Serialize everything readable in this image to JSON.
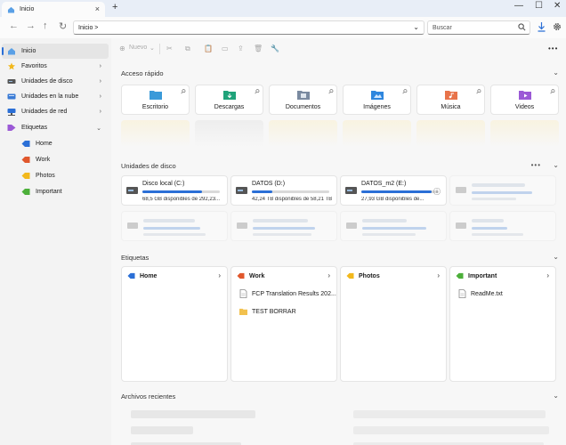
{
  "window": {
    "tab_label": "Inicio",
    "tab_close": "×",
    "new_tab": "+",
    "minimize": "—",
    "maximize": "☐",
    "close": "✕"
  },
  "nav": {
    "back": "←",
    "forward": "→",
    "up": "↑",
    "refresh": "↻",
    "address": "Inicio  >",
    "address_chevron": "⌄",
    "search_placeholder": "Buscar"
  },
  "sidebar": {
    "items": [
      {
        "label": "Inicio"
      },
      {
        "label": "Favoritos"
      },
      {
        "label": "Unidades de disco"
      },
      {
        "label": "Unidades en la nube"
      },
      {
        "label": "Unidades de red"
      },
      {
        "label": "Etiquetas"
      },
      {
        "label": "Home"
      },
      {
        "label": "Work"
      },
      {
        "label": "Photos"
      },
      {
        "label": "Important"
      }
    ],
    "chevron_right": "›",
    "chevron_down": "⌄"
  },
  "toolbar": {
    "new_label": "Nuevo",
    "new_chevron": "⌄",
    "more": "•••"
  },
  "quick_access": {
    "title": "Acceso rápido",
    "chevron": "⌄",
    "pin": "📌",
    "items": [
      {
        "label": "Escritorio",
        "color": "#3a9ad9"
      },
      {
        "label": "Descargas",
        "color": "#1fa37a"
      },
      {
        "label": "Documentos",
        "color": "#7a8aa0"
      },
      {
        "label": "Imágenes",
        "color": "#2e86de"
      },
      {
        "label": "Música",
        "color": "#e8734a"
      },
      {
        "label": "Videos",
        "color": "#9b59d6"
      }
    ]
  },
  "drives": {
    "title": "Unidades de disco",
    "dots": "•••",
    "chevron": "⌄",
    "items": [
      {
        "name": "Disco local (C:)",
        "free": "68,5 GB disponibles de 292,23...",
        "used_fraction": 0.77
      },
      {
        "name": "DATOS (D:)",
        "free": "42,24 TB disponibles de 58,21 TB",
        "used_fraction": 0.27
      },
      {
        "name": "DATOS_m2 (E:)",
        "free": "27,93 GB disponibles de...",
        "used_fraction": 0.91,
        "info": "ⓘ"
      }
    ]
  },
  "tags": {
    "title": "Etiquetas",
    "chevron": "⌄",
    "card_chevron": "›",
    "cards": [
      {
        "label": "Home",
        "color": "#2b6fd6",
        "files": []
      },
      {
        "label": "Work",
        "color": "#e0572c",
        "files": [
          {
            "name": "FCP Translation Results 202...",
            "kind": "document"
          },
          {
            "name": "TEST BORRAR",
            "kind": "folder"
          }
        ]
      },
      {
        "label": "Photos",
        "color": "#f2b81c",
        "files": []
      },
      {
        "label": "Important",
        "color": "#4caf3a",
        "files": [
          {
            "name": "ReadMe.txt",
            "kind": "document"
          }
        ]
      }
    ]
  },
  "recent": {
    "title": "Archivos recientes",
    "chevron": "⌄"
  }
}
